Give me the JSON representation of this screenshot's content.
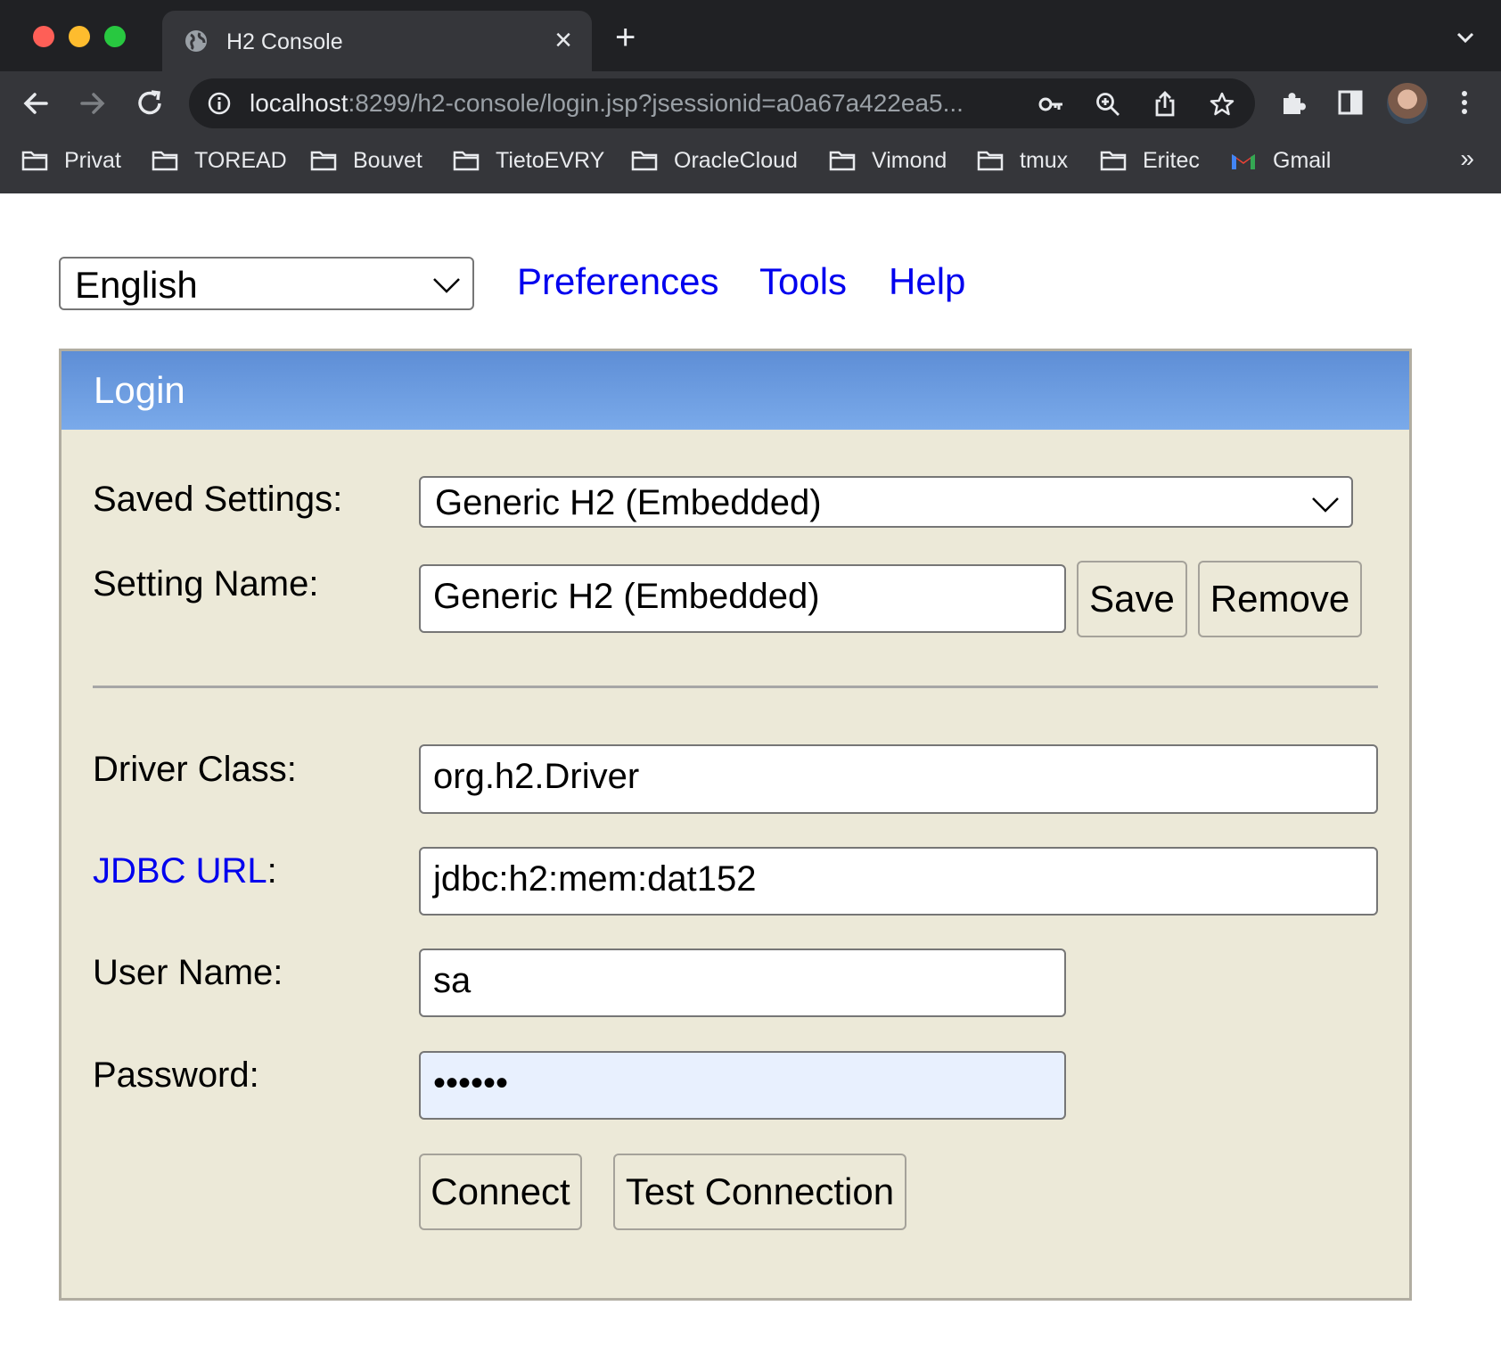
{
  "browser": {
    "tab_title": "H2 Console",
    "url_host": "localhost",
    "url_rest": ":8299/h2-console/login.jsp?jsessionid=a0a67a422ea5...",
    "bookmarks": [
      "Privat",
      "TOREAD",
      "Bouvet",
      "TietoEVRY",
      "OracleCloud",
      "Vimond",
      "tmux",
      "Eritec",
      "Gmail"
    ],
    "more": "»",
    "new_tab": "+"
  },
  "topbar": {
    "language": "English",
    "links": [
      "Preferences",
      "Tools",
      "Help"
    ]
  },
  "login": {
    "title": "Login",
    "saved_settings_label": "Saved Settings:",
    "saved_settings_value": "Generic H2 (Embedded)",
    "setting_name_label": "Setting Name:",
    "setting_name_value": "Generic H2 (Embedded)",
    "save_button": "Save",
    "remove_button": "Remove",
    "driver_class_label": "Driver Class:",
    "driver_class_value": "org.h2.Driver",
    "jdbc_url_link": "JDBC URL",
    "jdbc_url_colon": ":",
    "jdbc_url_value": "jdbc:h2:mem:dat152",
    "user_name_label": "User Name:",
    "user_name_value": "sa",
    "password_label": "Password:",
    "password_value": "••••••",
    "connect_button": "Connect",
    "test_button": "Test Connection"
  },
  "colors": {
    "link": "#0000ee",
    "panel_bg": "#ece9d8",
    "header_gradient_top": "#5e8ed6",
    "header_gradient_bottom": "#7aaaea",
    "autofill_bg": "#e8f0fe"
  }
}
